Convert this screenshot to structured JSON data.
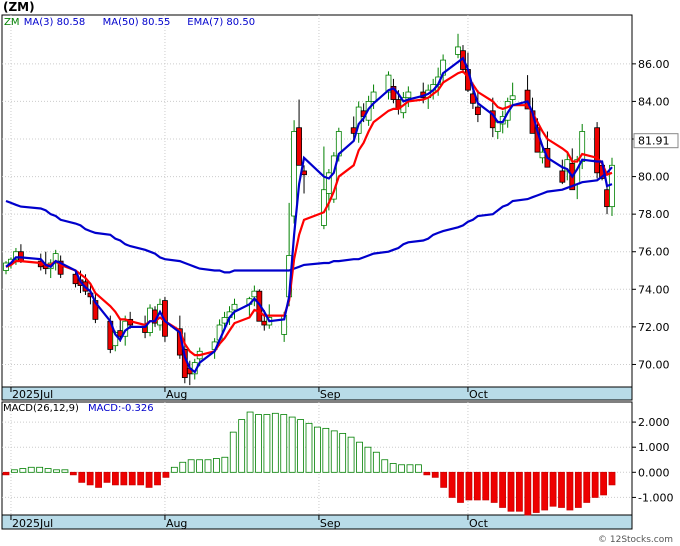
{
  "chart_data": [
    {
      "type": "candlestick",
      "title": "(ZM)",
      "legend": [
        {
          "label": "ZM",
          "color": "#008000"
        },
        {
          "label": "MA(3)",
          "value": "80.58",
          "color": "#0000cc"
        },
        {
          "label": "MA(50)",
          "value": "80.55",
          "color": "#0000cc"
        },
        {
          "label": "EMA(7)",
          "value": "80.50",
          "color": "#0000cc"
        }
      ],
      "last_price": "81.91",
      "ylim": [
        68.8,
        88.6
      ],
      "y_ticks": [
        "86.00",
        "84.00",
        "82.00",
        "80.00",
        "78.00",
        "76.00",
        "74.00",
        "72.00",
        "70.00"
      ],
      "x_labels": [
        "2025Jul",
        "Aug",
        "Sep",
        "Oct"
      ],
      "x_label_dates": [
        "2025-07-01",
        "2025-08-01",
        "2025-09-01",
        "2025-10-01"
      ],
      "dates": [
        "2025-06-30",
        "2025-07-01",
        "2025-07-02",
        "2025-07-03",
        "2025-07-07",
        "2025-07-08",
        "2025-07-09",
        "2025-07-10",
        "2025-07-11",
        "2025-07-14",
        "2025-07-15",
        "2025-07-16",
        "2025-07-17",
        "2025-07-18",
        "2025-07-21",
        "2025-07-22",
        "2025-07-23",
        "2025-07-24",
        "2025-07-25",
        "2025-07-28",
        "2025-07-29",
        "2025-07-30",
        "2025-07-31",
        "2025-08-01",
        "2025-08-04",
        "2025-08-05",
        "2025-08-06",
        "2025-08-07",
        "2025-08-08",
        "2025-08-11",
        "2025-08-12",
        "2025-08-13",
        "2025-08-14",
        "2025-08-15",
        "2025-08-18",
        "2025-08-19",
        "2025-08-20",
        "2025-08-21",
        "2025-08-22",
        "2025-08-25",
        "2025-08-26",
        "2025-08-27",
        "2025-08-28",
        "2025-08-29",
        "2025-09-02",
        "2025-09-03",
        "2025-09-04",
        "2025-09-05",
        "2025-09-08",
        "2025-09-09",
        "2025-09-10",
        "2025-09-11",
        "2025-09-12",
        "2025-09-15",
        "2025-09-16",
        "2025-09-17",
        "2025-09-18",
        "2025-09-19",
        "2025-09-22",
        "2025-09-23",
        "2025-09-24",
        "2025-09-25",
        "2025-09-26",
        "2025-09-29",
        "2025-09-30",
        "2025-10-01",
        "2025-10-02",
        "2025-10-03",
        "2025-10-06",
        "2025-10-07",
        "2025-10-08",
        "2025-10-09",
        "2025-10-10",
        "2025-10-13",
        "2025-10-14",
        "2025-10-15",
        "2025-10-16",
        "2025-10-17",
        "2025-10-20",
        "2025-10-21",
        "2025-10-22",
        "2025-10-23",
        "2025-10-24",
        "2025-10-27",
        "2025-10-28",
        "2025-10-29",
        "2025-10-30"
      ],
      "ohlc": [
        [
          75.0,
          75.5,
          74.8,
          75.4
        ],
        [
          75.4,
          75.7,
          75.1,
          75.6
        ],
        [
          75.6,
          76.2,
          75.3,
          76.0
        ],
        [
          76.0,
          76.4,
          75.4,
          75.5
        ],
        [
          75.5,
          75.9,
          75.0,
          75.2
        ],
        [
          75.3,
          76.0,
          74.8,
          75.1
        ],
        [
          75.1,
          75.6,
          74.6,
          75.4
        ],
        [
          75.4,
          76.1,
          75.0,
          75.9
        ],
        [
          75.5,
          75.8,
          74.6,
          74.8
        ],
        [
          74.8,
          75.0,
          74.1,
          74.3
        ],
        [
          74.5,
          75.0,
          73.8,
          74.2
        ],
        [
          74.4,
          74.8,
          73.7,
          73.9
        ],
        [
          73.8,
          74.3,
          73.2,
          73.6
        ],
        [
          73.4,
          73.8,
          72.2,
          72.4
        ],
        [
          72.3,
          72.6,
          70.6,
          70.8
        ],
        [
          71.0,
          71.8,
          70.7,
          71.7
        ],
        [
          71.8,
          72.4,
          71.2,
          71.5
        ],
        [
          71.5,
          72.6,
          71.0,
          72.3
        ],
        [
          72.4,
          72.8,
          71.9,
          72.1
        ],
        [
          72.0,
          72.6,
          71.4,
          71.7
        ],
        [
          71.7,
          73.2,
          71.5,
          73.0
        ],
        [
          72.9,
          73.1,
          72.0,
          72.2
        ],
        [
          72.1,
          73.5,
          71.8,
          73.2
        ],
        [
          73.4,
          73.6,
          71.2,
          71.5
        ],
        [
          71.9,
          72.6,
          70.3,
          70.5
        ],
        [
          70.8,
          71.7,
          69.0,
          69.3
        ],
        [
          69.8,
          70.2,
          68.9,
          69.5
        ],
        [
          69.5,
          70.3,
          69.2,
          70.1
        ],
        [
          70.3,
          70.9,
          69.9,
          70.7
        ],
        [
          70.8,
          71.4,
          70.3,
          71.2
        ],
        [
          71.3,
          72.4,
          71.0,
          72.1
        ],
        [
          72.2,
          72.8,
          71.8,
          72.5
        ],
        [
          72.5,
          73.1,
          72.1,
          72.8
        ],
        [
          72.9,
          73.5,
          72.4,
          73.2
        ],
        [
          73.2,
          73.6,
          72.6,
          73.5
        ],
        [
          73.6,
          74.2,
          73.1,
          73.9
        ],
        [
          73.9,
          74.0,
          72.5,
          72.3
        ],
        [
          72.3,
          72.9,
          71.8,
          72.1
        ],
        [
          72.1,
          73.2,
          71.9,
          72.5
        ],
        [
          71.6,
          72.8,
          71.2,
          72.6
        ],
        [
          73.6,
          78.6,
          73.1,
          75.8
        ],
        [
          77.9,
          83.0,
          77.5,
          82.4
        ],
        [
          82.6,
          84.1,
          80.8,
          80.6
        ],
        [
          80.3,
          80.6,
          79.1,
          80.1
        ],
        [
          77.4,
          81.6,
          77.2,
          79.3
        ],
        [
          79.1,
          80.4,
          78.2,
          80.2
        ],
        [
          78.8,
          81.3,
          78.6,
          81.1
        ],
        [
          81.1,
          82.6,
          80.8,
          82.4
        ],
        [
          82.6,
          83.2,
          82.0,
          82.3
        ],
        [
          82.3,
          84.0,
          81.8,
          83.7
        ],
        [
          83.5,
          83.9,
          82.9,
          83.2
        ],
        [
          83.0,
          84.3,
          82.7,
          84.0
        ],
        [
          84.0,
          84.9,
          83.6,
          84.5
        ],
        [
          84.5,
          85.6,
          84.1,
          85.4
        ],
        [
          84.8,
          85.2,
          83.9,
          84.1
        ],
        [
          84.1,
          84.6,
          83.3,
          83.6
        ],
        [
          83.4,
          84.5,
          83.1,
          84.2
        ],
        [
          84.2,
          84.8,
          83.7,
          84.5
        ],
        [
          84.5,
          85.0,
          83.9,
          84.2
        ],
        [
          84.2,
          84.9,
          83.6,
          84.6
        ],
        [
          84.6,
          85.2,
          84.1,
          84.9
        ],
        [
          84.9,
          85.8,
          84.3,
          85.3
        ],
        [
          85.4,
          86.5,
          85.0,
          86.2
        ],
        [
          86.5,
          87.6,
          86.3,
          86.9
        ],
        [
          86.7,
          87.0,
          85.5,
          85.7
        ],
        [
          85.7,
          86.6,
          84.5,
          84.6
        ],
        [
          84.4,
          85.0,
          83.6,
          83.9
        ],
        [
          83.7,
          84.6,
          82.9,
          83.3
        ],
        [
          83.5,
          84.2,
          82.1,
          82.6
        ],
        [
          82.4,
          83.0,
          82.0,
          82.9
        ],
        [
          82.8,
          83.5,
          82.3,
          83.2
        ],
        [
          83.0,
          84.2,
          82.6,
          84.0
        ],
        [
          84.1,
          85.0,
          83.8,
          84.3
        ],
        [
          84.6,
          85.4,
          84.1,
          83.6
        ],
        [
          83.5,
          84.2,
          82.7,
          82.3
        ],
        [
          82.6,
          83.1,
          81.4,
          81.3
        ],
        [
          81.0,
          81.6,
          80.7,
          81.3
        ],
        [
          81.5,
          82.4,
          80.8,
          80.5
        ],
        [
          80.3,
          80.9,
          79.6,
          79.7
        ],
        [
          80.3,
          81.3,
          79.8,
          80.9
        ],
        [
          80.7,
          81.5,
          79.4,
          79.3
        ],
        [
          79.6,
          81.1,
          78.8,
          80.9
        ],
        [
          80.8,
          82.8,
          80.4,
          82.4
        ],
        [
          82.6,
          82.9,
          79.9,
          80.2
        ],
        [
          80.6,
          80.7,
          79.8,
          79.9
        ],
        [
          79.3,
          79.6,
          78.0,
          78.4
        ],
        [
          78.4,
          81.0,
          77.9,
          80.6
        ]
      ],
      "series": [
        {
          "name": "MA(3)",
          "color": "#0000cc",
          "values": [
            75.2,
            75.4,
            75.7,
            75.7,
            75.6,
            75.3,
            75.2,
            75.5,
            75.4,
            75.0,
            74.4,
            74.1,
            73.9,
            73.3,
            72.3,
            71.6,
            71.3,
            71.8,
            72.0,
            72.0,
            72.3,
            72.3,
            72.8,
            72.3,
            71.7,
            70.4,
            69.8,
            69.6,
            70.1,
            70.7,
            71.3,
            71.9,
            72.5,
            72.8,
            73.2,
            73.5,
            73.2,
            72.8,
            72.3,
            72.4,
            73.6,
            76.9,
            79.6,
            81.0,
            80.0,
            79.9,
            80.2,
            81.2,
            81.9,
            82.8,
            83.1,
            83.6,
            83.9,
            84.6,
            84.7,
            84.4,
            84.0,
            84.1,
            84.3,
            84.4,
            84.6,
            84.9,
            85.5,
            86.1,
            86.3,
            85.7,
            84.7,
            83.9,
            83.3,
            82.9,
            82.9,
            83.4,
            83.8,
            84.0,
            83.4,
            82.4,
            81.6,
            81.0,
            80.5,
            80.4,
            80.0,
            80.4,
            80.9,
            80.8,
            80.8,
            79.5,
            79.6
          ]
        },
        {
          "name": "EMA(7)",
          "color": "#ff0000",
          "values": [
            75.2,
            75.3,
            75.5,
            75.5,
            75.4,
            75.3,
            75.3,
            75.5,
            75.3,
            75.0,
            74.8,
            74.6,
            74.3,
            73.8,
            73.1,
            72.8,
            72.4,
            72.4,
            72.3,
            72.1,
            72.3,
            72.3,
            72.5,
            72.3,
            71.8,
            71.1,
            70.7,
            70.5,
            70.5,
            70.7,
            71.1,
            71.4,
            71.8,
            72.2,
            72.5,
            72.9,
            72.8,
            72.6,
            72.6,
            72.6,
            73.4,
            75.6,
            76.9,
            77.7,
            78.1,
            78.6,
            79.2,
            80.0,
            80.6,
            81.4,
            81.8,
            82.4,
            82.9,
            83.5,
            83.6,
            83.6,
            83.8,
            84.0,
            84.1,
            84.2,
            84.4,
            84.6,
            85.0,
            85.5,
            85.6,
            85.3,
            84.9,
            84.5,
            84.0,
            83.7,
            83.6,
            83.7,
            83.8,
            83.8,
            83.4,
            82.9,
            82.4,
            82.0,
            81.5,
            81.3,
            80.8,
            80.8,
            81.2,
            81.0,
            80.7,
            80.1,
            80.2
          ]
        },
        {
          "name": "MA(50)",
          "color": "#0000cc",
          "values": [
            78.7,
            78.6,
            78.5,
            78.4,
            78.3,
            78.2,
            78.0,
            77.9,
            77.7,
            77.5,
            77.4,
            77.2,
            77.1,
            77.0,
            76.9,
            76.7,
            76.6,
            76.4,
            76.3,
            76.1,
            76.0,
            75.9,
            75.7,
            75.6,
            75.5,
            75.4,
            75.3,
            75.2,
            75.1,
            75.0,
            75.0,
            74.9,
            74.9,
            75.0,
            75.0,
            75.0,
            75.0,
            75.0,
            75.0,
            75.0,
            75.0,
            75.1,
            75.2,
            75.3,
            75.4,
            75.4,
            75.5,
            75.5,
            75.6,
            75.6,
            75.7,
            75.8,
            75.9,
            76.0,
            76.1,
            76.2,
            76.4,
            76.5,
            76.6,
            76.7,
            76.9,
            77.0,
            77.1,
            77.3,
            77.4,
            77.6,
            77.7,
            77.9,
            78.0,
            78.2,
            78.4,
            78.5,
            78.7,
            78.8,
            78.9,
            79.0,
            79.1,
            79.2,
            79.3,
            79.4,
            79.5,
            79.6,
            79.7,
            79.8,
            80.0,
            80.2,
            80.5
          ]
        }
      ]
    },
    {
      "type": "bar",
      "title": "MACD(26,12,9)",
      "label": "MACD:-0.326",
      "ylim": [
        -1.7,
        2.8
      ],
      "y_ticks": [
        "2.000",
        "1.000",
        "0.000",
        "-1.000"
      ],
      "x_labels": [
        "2025Jul",
        "Aug",
        "Sep",
        "Oct"
      ],
      "values": [
        -0.1,
        0.1,
        0.15,
        0.2,
        0.2,
        0.15,
        0.1,
        0.1,
        -0.1,
        -0.4,
        -0.5,
        -0.6,
        -0.4,
        -0.5,
        -0.5,
        -0.5,
        -0.5,
        -0.6,
        -0.5,
        -0.2,
        0.2,
        0.4,
        0.5,
        0.5,
        0.5,
        0.55,
        0.6,
        1.6,
        2.1,
        2.4,
        2.3,
        2.3,
        2.35,
        2.3,
        2.2,
        2.1,
        1.95,
        1.8,
        1.75,
        1.65,
        1.55,
        1.4,
        1.2,
        1.0,
        0.8,
        0.5,
        0.35,
        0.3,
        0.3,
        0.3,
        -0.1,
        -0.2,
        -0.6,
        -1.0,
        -1.2,
        -1.1,
        -1.1,
        -1.1,
        -1.2,
        -1.4,
        -1.55,
        -1.55,
        -1.7,
        -1.6,
        -1.5,
        -1.35,
        -1.4,
        -1.5,
        -1.4,
        -1.2,
        -1.0,
        -0.9,
        -0.5
      ]
    }
  ],
  "watermark": "© 12Stocks.com"
}
